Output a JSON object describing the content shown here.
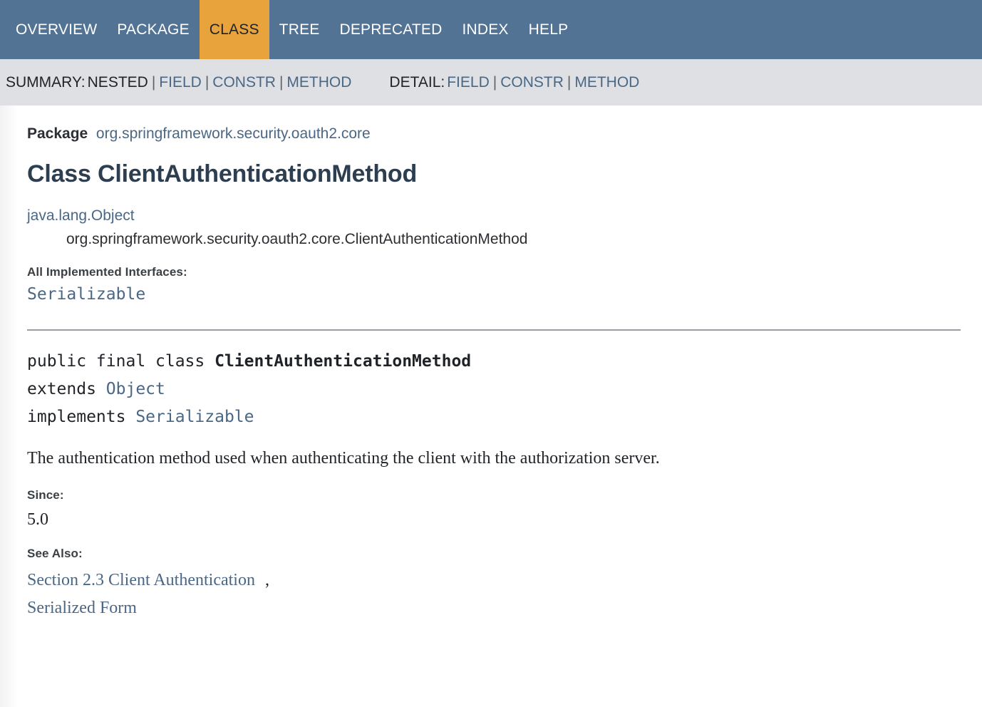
{
  "top_nav": {
    "items": [
      {
        "label": "OVERVIEW",
        "active": false
      },
      {
        "label": "PACKAGE",
        "active": false
      },
      {
        "label": "CLASS",
        "active": true
      },
      {
        "label": "TREE",
        "active": false
      },
      {
        "label": "DEPRECATED",
        "active": false
      },
      {
        "label": "INDEX",
        "active": false
      },
      {
        "label": "HELP",
        "active": false
      }
    ],
    "background_color": "#527394",
    "active_color": "#e8a33d"
  },
  "sub_nav": {
    "summary_label": "SUMMARY:",
    "summary_items": [
      {
        "label": "NESTED",
        "link": false
      },
      {
        "label": "FIELD",
        "link": true
      },
      {
        "label": "CONSTR",
        "link": true
      },
      {
        "label": "METHOD",
        "link": true
      }
    ],
    "detail_label": "DETAIL:",
    "detail_items": [
      {
        "label": "FIELD",
        "link": true
      },
      {
        "label": "CONSTR",
        "link": true
      },
      {
        "label": "METHOD",
        "link": true
      }
    ],
    "separator": "|",
    "background_color": "#dee0e3",
    "link_color": "#4a6785"
  },
  "main": {
    "package_label": "Package",
    "package_name": "org.springframework.security.oauth2.core",
    "class_title": "Class ClientAuthenticationMethod",
    "inheritance": {
      "super": "java.lang.Object",
      "self": "org.springframework.security.oauth2.core.ClientAuthenticationMethod"
    },
    "implemented_interfaces_label": "All Implemented Interfaces:",
    "implemented_interfaces": [
      "Serializable"
    ],
    "declaration": {
      "modifiers": "public final class ",
      "class_name": "ClientAuthenticationMethod",
      "extends_keyword": "extends ",
      "extends_type": "Object",
      "implements_keyword": "implements ",
      "implements_type": "Serializable"
    },
    "description": "The authentication method used when authenticating the client with the authorization server.",
    "since_label": "Since:",
    "since_value": "5.0",
    "see_also_label": "See Also:",
    "see_also": [
      "Section 2.3 Client Authentication",
      "Serialized Form"
    ],
    "see_also_separator": ","
  }
}
